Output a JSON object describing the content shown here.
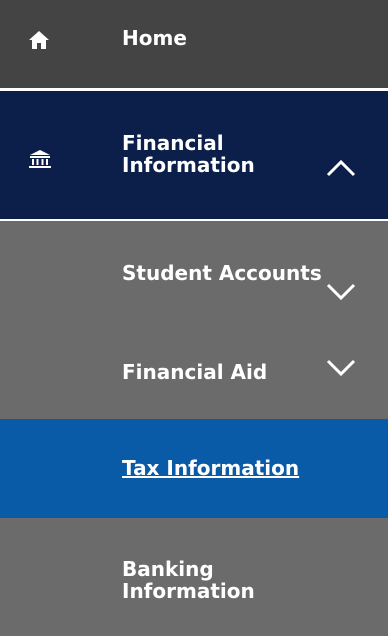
{
  "nav": {
    "home": {
      "label": "Home",
      "icon": "home-icon"
    },
    "financial_information": {
      "label_line1": "Financial",
      "label_line2": "Information",
      "icon": "bank-icon",
      "state": "expanded"
    },
    "sub_items": {
      "student_accounts": {
        "label": "Student Accounts",
        "state": "collapsed"
      },
      "financial_aid": {
        "label": "Financial Aid",
        "state": "collapsed"
      },
      "tax_information": {
        "label": "Tax Information",
        "state": "active"
      },
      "banking_information": {
        "label_line1": "Banking",
        "label_line2": "Information"
      }
    }
  },
  "colors": {
    "home_bg": "#444444",
    "section_bg": "#0c1e4a",
    "submenu_bg": "#6b6b6b",
    "active_bg": "#0a5ba7",
    "text": "#ffffff"
  }
}
